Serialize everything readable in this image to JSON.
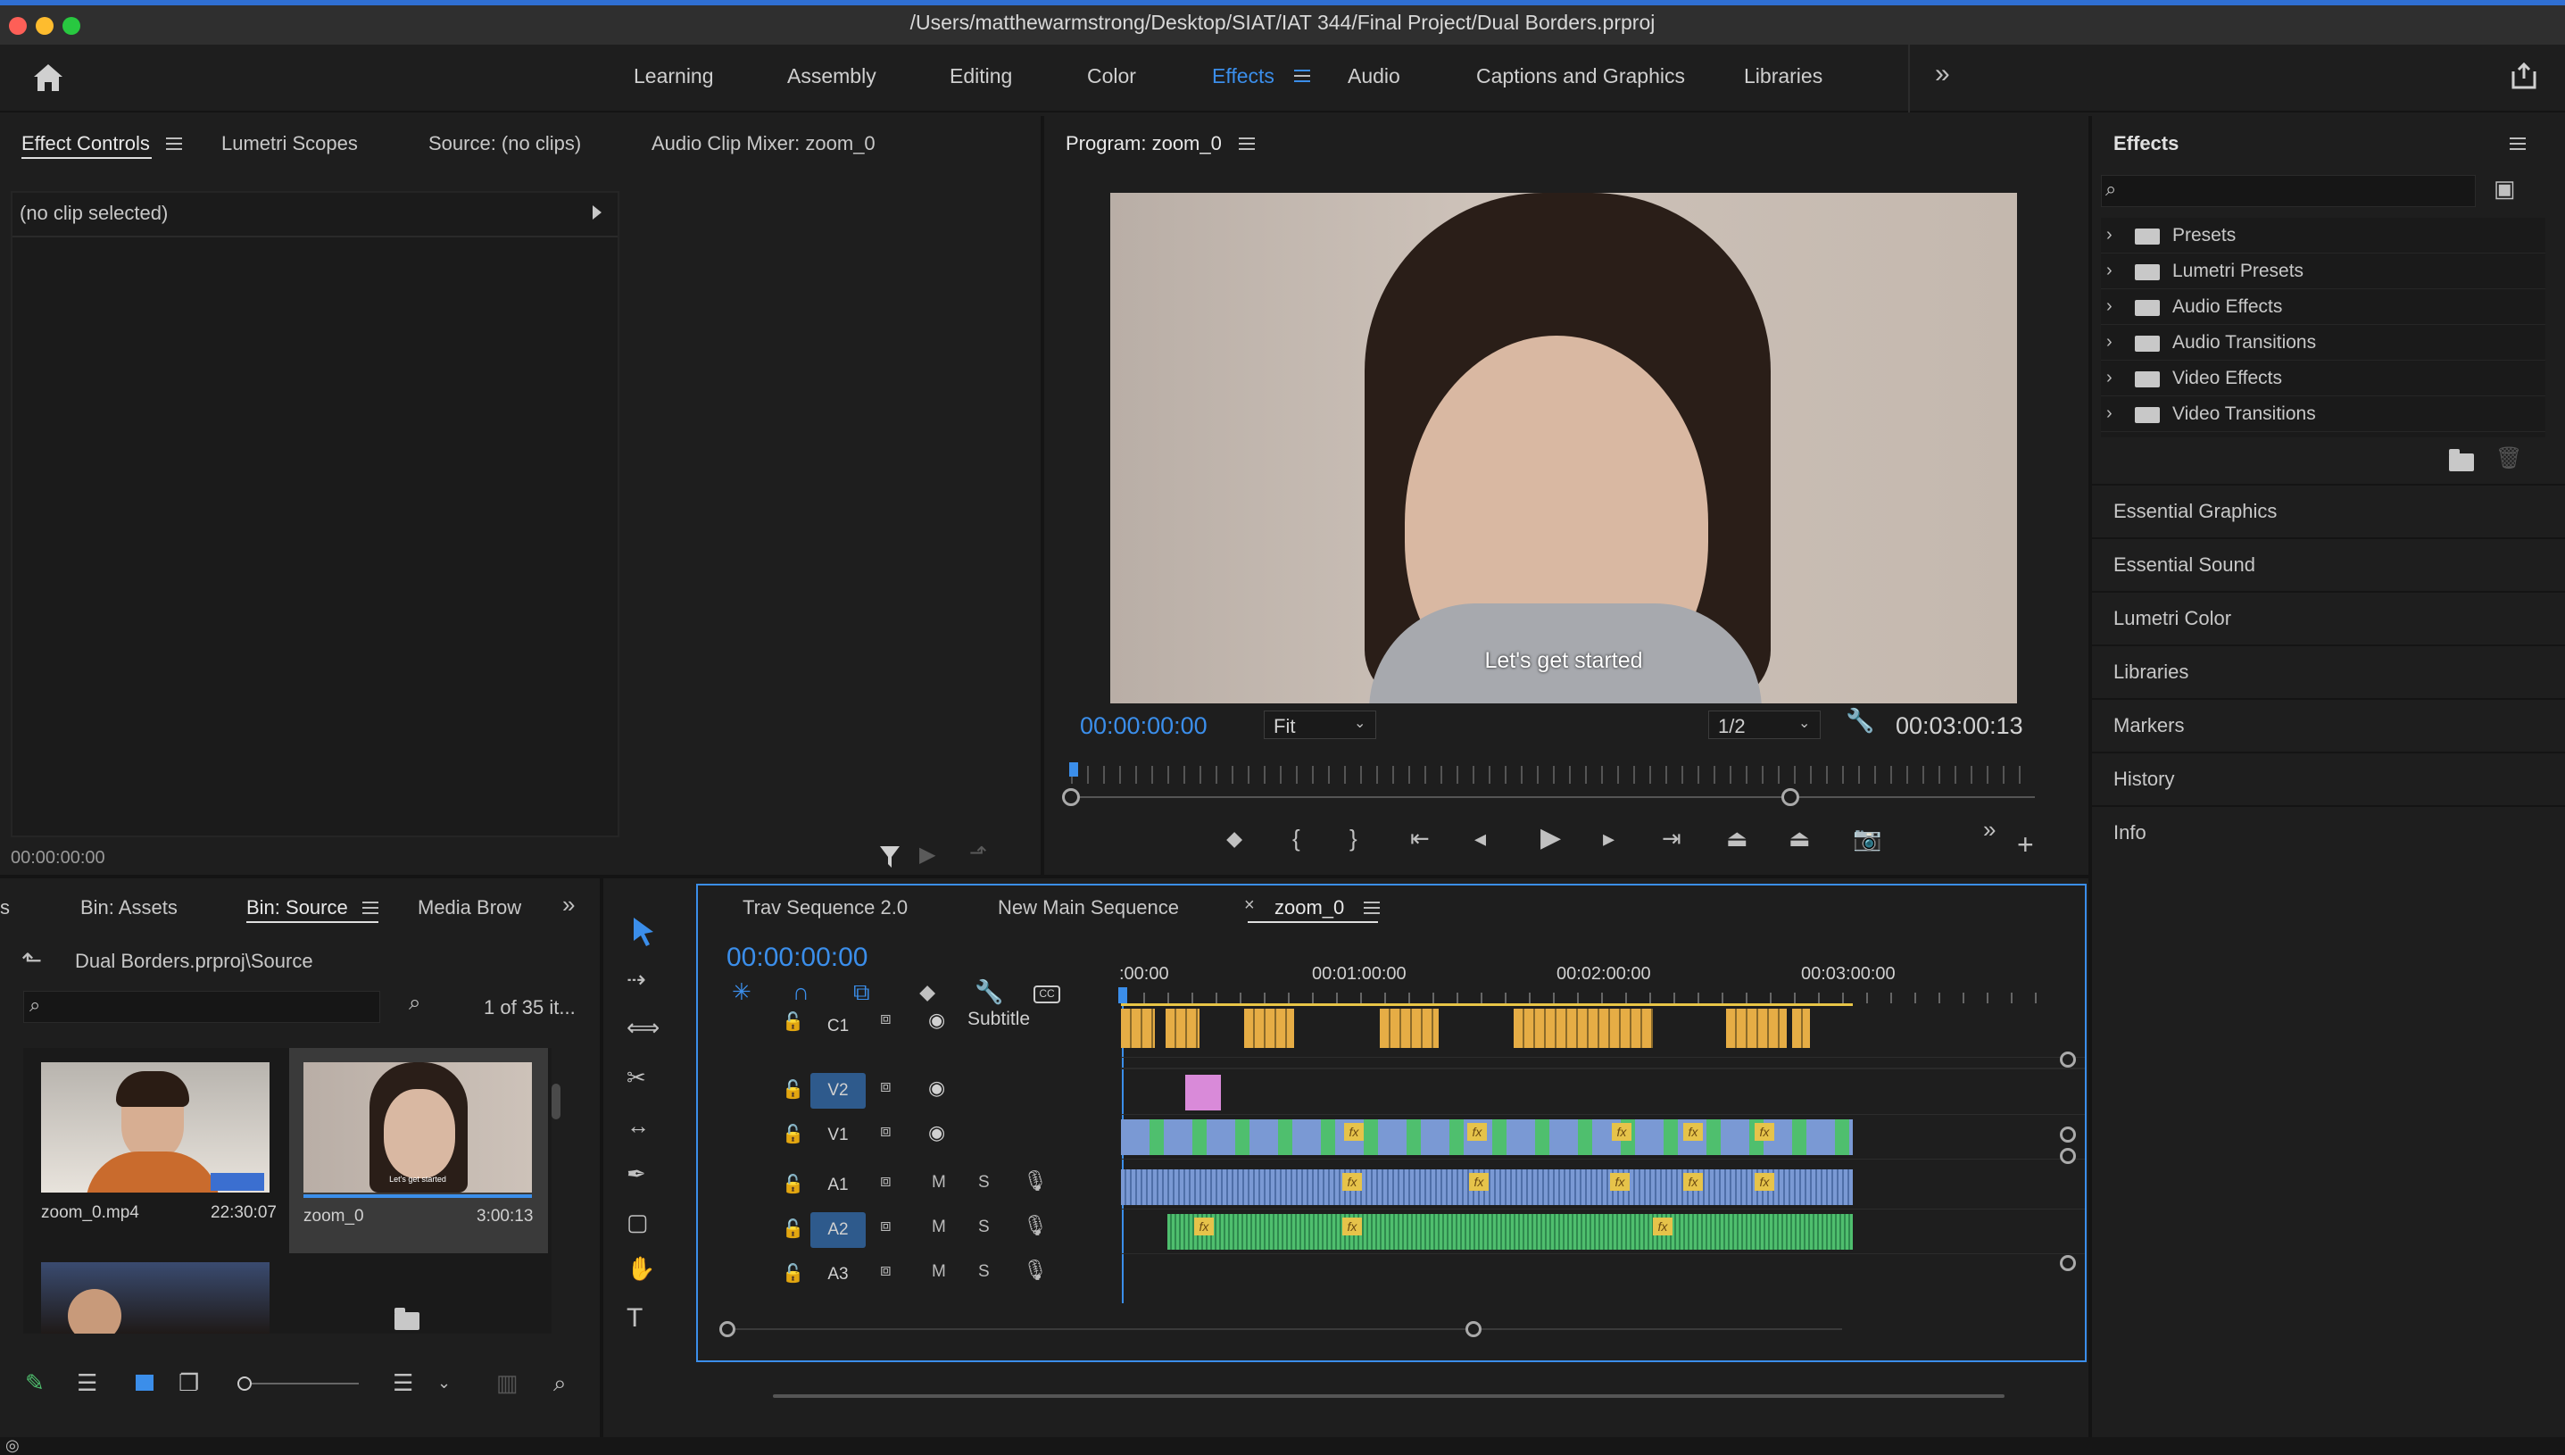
{
  "window": {
    "title": "/Users/matthewarmstrong/Desktop/SIAT/IAT 344/Final Project/Dual Borders.prproj"
  },
  "workspaces": [
    "Learning",
    "Assembly",
    "Editing",
    "Color",
    "Effects",
    "Audio",
    "Captions and Graphics",
    "Libraries"
  ],
  "active_workspace": "Effects",
  "source_panel": {
    "tabs": [
      "Effect Controls",
      "Lumetri Scopes",
      "Source: (no clips)",
      "Audio Clip Mixer: zoom_0"
    ],
    "no_clip": "(no clip selected)",
    "timecode": "00:00:00:00"
  },
  "program": {
    "title": "Program: zoom_0",
    "timecode_left": "00:00:00:00",
    "fit": "Fit",
    "resolution": "1/2",
    "timecode_right": "00:03:00:13",
    "caption": "Let's get started"
  },
  "effects_panel": {
    "title": "Effects",
    "tree": [
      "Presets",
      "Lumetri Presets",
      "Audio Effects",
      "Audio Transitions",
      "Video Effects",
      "Video Transitions"
    ],
    "collapsed": [
      "Essential Graphics",
      "Essential Sound",
      "Lumetri Color",
      "Libraries",
      "Markers",
      "History",
      "Info"
    ]
  },
  "project": {
    "tabs": [
      "Bin: Assets",
      "Bin: Source",
      "Media Brow"
    ],
    "path": "Dual Borders.prproj\\Source",
    "count": "1 of 35 it...",
    "items": [
      {
        "name": "zoom_0.mp4",
        "duration": "22:30:07"
      },
      {
        "name": "zoom_0",
        "duration": "3:00:13"
      }
    ],
    "thumb_caption": "Let's get started"
  },
  "timeline": {
    "tabs": [
      "Trav Sequence 2.0",
      "New Main Sequence",
      "zoom_0"
    ],
    "timecode": "00:00:00:00",
    "ruler": [
      ":00:00",
      "00:01:00:00",
      "00:02:00:00",
      "00:03:00:00"
    ],
    "tracks": {
      "caption": {
        "label": "C1",
        "name": "Subtitle"
      },
      "video": [
        "V2",
        "V1"
      ],
      "audio": [
        "A1",
        "A2",
        "A3"
      ],
      "mute": "M",
      "solo": "S"
    },
    "fx": "fx"
  },
  "colors": {
    "accent": "#3b8eea",
    "caption_clip": "#e6ad45",
    "video_clip": "#7a99d4",
    "audio_clip": "#4fbf6e",
    "pink_clip": "#d98ad9"
  }
}
